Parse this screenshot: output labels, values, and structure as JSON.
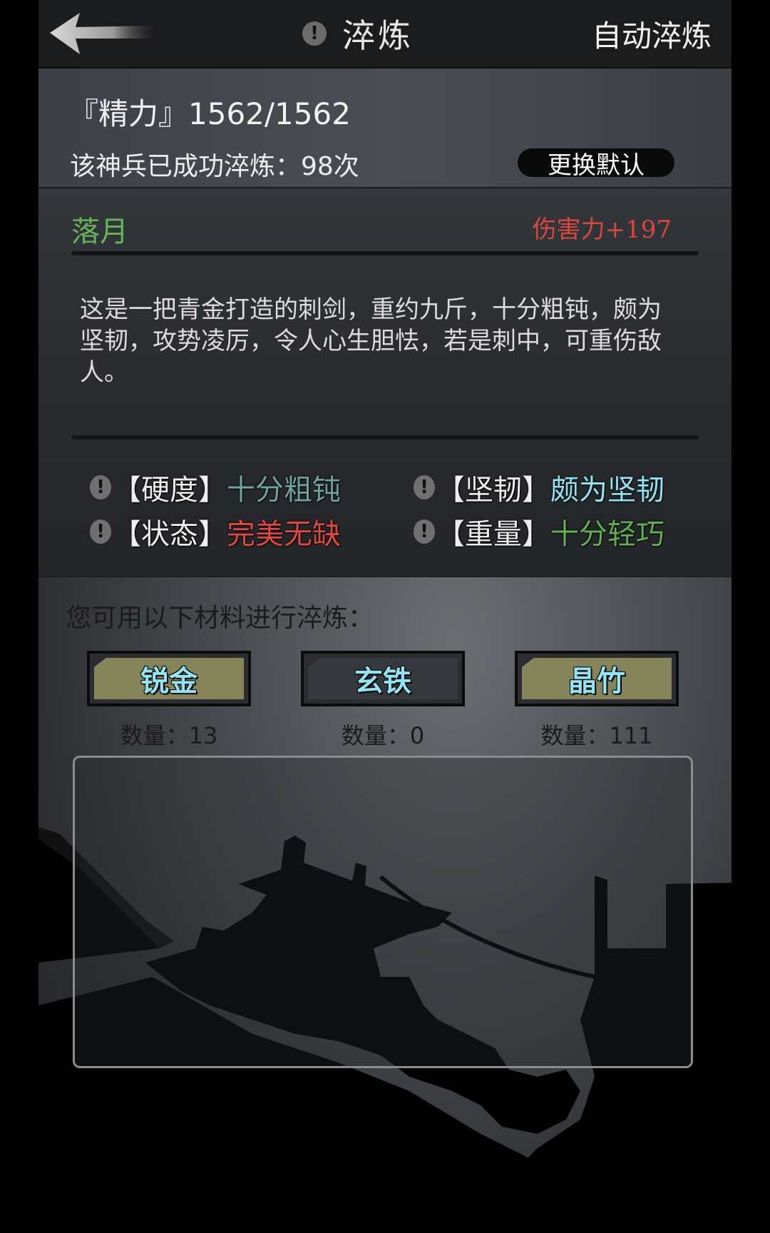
{
  "header": {
    "title": "淬炼",
    "info_icon": "!",
    "auto_button": "自动淬炼"
  },
  "info": {
    "energy": "『精力』1562/1562",
    "tempered_count": "该神兵已成功淬炼：98次",
    "change_default": "更换默认"
  },
  "weapon": {
    "name": "落月",
    "stat": "伤害力+197",
    "description": "这是一把青金打造的刺剑，重约九斤，十分粗钝，颇为坚韧，攻势凌厉，令人心生胆怯，若是刺中，可重伤敌人。",
    "attributes": [
      {
        "label": "【硬度】",
        "value": "十分粗钝",
        "color": "#6fa3a0"
      },
      {
        "label": "【坚韧】",
        "value": "颇为坚韧",
        "color": "#8fe6f2"
      },
      {
        "label": "【状态】",
        "value": "完美无缺",
        "color": "#e04a3c"
      },
      {
        "label": "【重量】",
        "value": "十分轻巧",
        "color": "#5fb04f"
      }
    ]
  },
  "materials": {
    "label": "您可用以下材料进行淬炼：",
    "items": [
      {
        "name": "锐金",
        "quantity": "数量：13",
        "color": "#86845a"
      },
      {
        "name": "玄铁",
        "quantity": "数量：0",
        "color": "#35383c"
      },
      {
        "name": "晶竹",
        "quantity": "数量：111",
        "color": "#86845a"
      }
    ]
  },
  "colors": {
    "header_bg": "#1b1c1e",
    "weapon_name": "#67b35a",
    "weapon_stat": "#d8483e",
    "material_text": "#8fe6f2"
  }
}
